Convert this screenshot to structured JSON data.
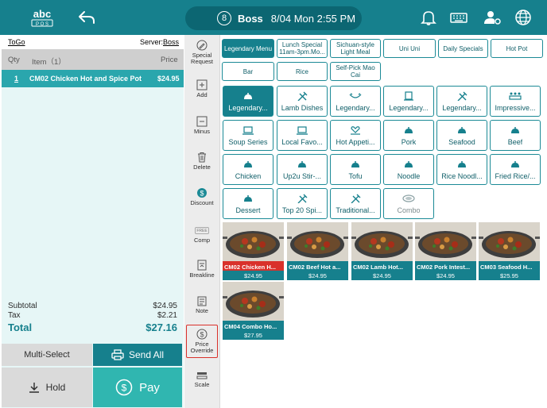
{
  "header": {
    "logo_text": "abc POS",
    "user_initial": "8",
    "user_name": "Boss",
    "datetime": "8/04 Mon 2:55 PM",
    "icons": [
      "back-arrow-icon",
      "bell-icon",
      "keyboard-icon",
      "user-settings-icon",
      "globe-icon"
    ]
  },
  "order": {
    "type": "ToGo",
    "server_label": "Server:",
    "server_name": "Boss",
    "columns": {
      "qty": "Qty",
      "item": "Item（1）",
      "price": "Price"
    },
    "items": [
      {
        "qty": "1",
        "name": "CM02 Chicken Hot and Spice Pot",
        "price": "$24.95"
      }
    ],
    "subtotal_label": "Subtotal",
    "subtotal": "$24.95",
    "tax_label": "Tax",
    "tax": "$2.21",
    "total_label": "Total",
    "total": "$27.16"
  },
  "actions": {
    "multi_select": "Multi-Select",
    "send_all": "Send All",
    "hold": "Hold",
    "pay": "Pay"
  },
  "tools": [
    {
      "label": "Special Request",
      "icon": "pencil-icon"
    },
    {
      "label": "Add",
      "icon": "plus-icon"
    },
    {
      "label": "Minus",
      "icon": "minus-icon"
    },
    {
      "label": "Delete",
      "icon": "trash-icon"
    },
    {
      "label": "Discount",
      "icon": "dollar-badge-icon"
    },
    {
      "label": "Comp",
      "icon": "free-tag-icon",
      "badge": "FREE"
    },
    {
      "label": "Breakline",
      "icon": "breakline-icon"
    },
    {
      "label": "Note",
      "icon": "note-icon"
    },
    {
      "label": "Price Override",
      "icon": "price-override-icon"
    },
    {
      "label": "Scale",
      "icon": "scale-icon"
    }
  ],
  "menus": [
    {
      "label": "Legendary Menu",
      "selected": true
    },
    {
      "label": "Lunch Special 11am-3pm.Mo...",
      "selected": false
    },
    {
      "label": "Sichuan-style Light Meal",
      "selected": false
    },
    {
      "label": "Uni Uni",
      "selected": false
    },
    {
      "label": "Daily Specials",
      "selected": false
    },
    {
      "label": "Hot Pot",
      "selected": false
    },
    {
      "label": "Bar",
      "selected": false
    },
    {
      "label": "Rice",
      "selected": false
    },
    {
      "label": "Self-Pick Mao Cai",
      "selected": false
    }
  ],
  "categories": [
    {
      "label": "Legendary...",
      "icon": "cloche-icon",
      "selected": true
    },
    {
      "label": "Lamb Dishes",
      "icon": "chef-tools-icon"
    },
    {
      "label": "Legendary...",
      "icon": "bowl-icon"
    },
    {
      "label": "Legendary...",
      "icon": "cup-icon"
    },
    {
      "label": "Legendary...",
      "icon": "chef-tools-icon"
    },
    {
      "label": "Impressive...",
      "icon": "table-icon"
    },
    {
      "label": "Soup Series",
      "icon": "laptop-icon"
    },
    {
      "label": "Local Favo...",
      "icon": "laptop-icon"
    },
    {
      "label": "Hot Appeti...",
      "icon": "heart-plate-icon"
    },
    {
      "label": "Pork",
      "icon": "cloche-icon"
    },
    {
      "label": "Seafood",
      "icon": "cloche-icon"
    },
    {
      "label": "Beef",
      "icon": "cloche-icon"
    },
    {
      "label": "Chicken",
      "icon": "cloche-icon"
    },
    {
      "label": "Up2u Stir-...",
      "icon": "cloche-icon"
    },
    {
      "label": "Tofu",
      "icon": "cloche-icon"
    },
    {
      "label": "Noodle",
      "icon": "cloche-icon"
    },
    {
      "label": "Rice Noodl...",
      "icon": "cloche-icon"
    },
    {
      "label": "Fried Rice/...",
      "icon": "cloche-icon"
    },
    {
      "label": "Dessert",
      "icon": "cloche-icon"
    },
    {
      "label": "Top 20 Spi...",
      "icon": "chef-tools-icon"
    },
    {
      "label": "Traditional...",
      "icon": "chef-tools-icon"
    },
    {
      "label": "Combo",
      "icon": "dish-icon",
      "muted": true
    }
  ],
  "items": [
    {
      "name": "CM02 Chicken H...",
      "price": "$24.95",
      "highlight": true
    },
    {
      "name": "CM02 Beef Hot a...",
      "price": "$24.95"
    },
    {
      "name": "CM02 Lamb Hot...",
      "price": "$24.95"
    },
    {
      "name": "CM02 Pork Intest...",
      "price": "$24.95"
    },
    {
      "name": "CM03 Seafood H...",
      "price": "$25.95"
    },
    {
      "name": "CM04 Combo Ho...",
      "price": "$27.95"
    }
  ],
  "colors": {
    "accent": "#16808d",
    "accent_dark": "#0c6672",
    "pay": "#30b6b0",
    "highlight": "#d9312b",
    "panel": "#e6f6f6"
  }
}
